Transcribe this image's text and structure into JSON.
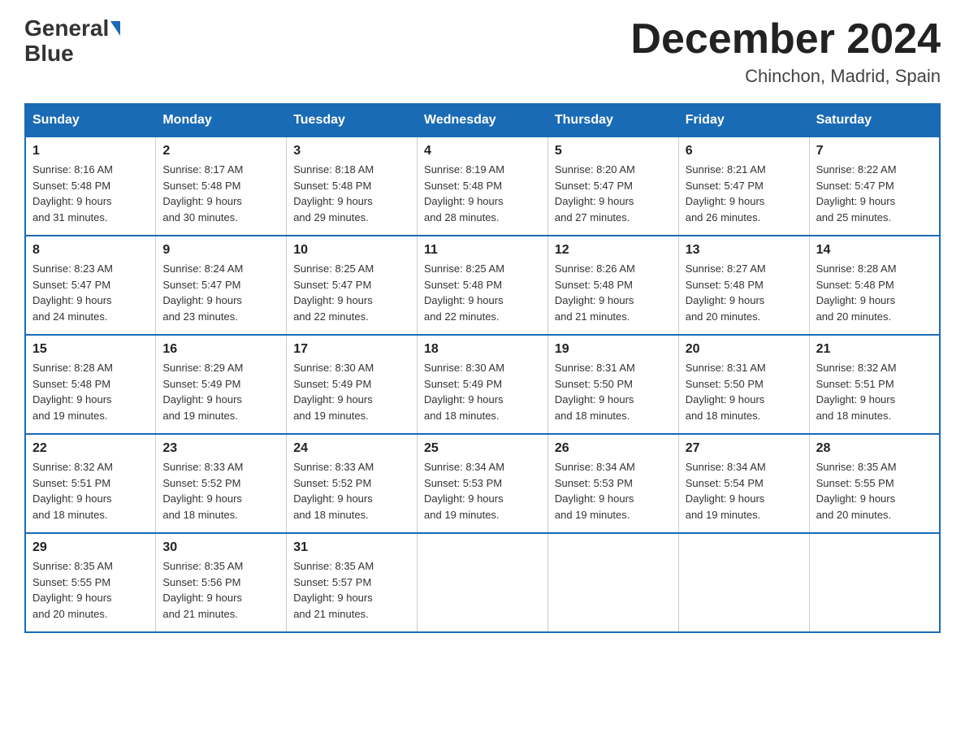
{
  "header": {
    "logo_general": "General",
    "logo_blue": "Blue",
    "month_title": "December 2024",
    "location": "Chinchon, Madrid, Spain"
  },
  "weekdays": [
    "Sunday",
    "Monday",
    "Tuesday",
    "Wednesday",
    "Thursday",
    "Friday",
    "Saturday"
  ],
  "weeks": [
    [
      {
        "day": "1",
        "sunrise": "8:16 AM",
        "sunset": "5:48 PM",
        "daylight": "9 hours and 31 minutes."
      },
      {
        "day": "2",
        "sunrise": "8:17 AM",
        "sunset": "5:48 PM",
        "daylight": "9 hours and 30 minutes."
      },
      {
        "day": "3",
        "sunrise": "8:18 AM",
        "sunset": "5:48 PM",
        "daylight": "9 hours and 29 minutes."
      },
      {
        "day": "4",
        "sunrise": "8:19 AM",
        "sunset": "5:48 PM",
        "daylight": "9 hours and 28 minutes."
      },
      {
        "day": "5",
        "sunrise": "8:20 AM",
        "sunset": "5:47 PM",
        "daylight": "9 hours and 27 minutes."
      },
      {
        "day": "6",
        "sunrise": "8:21 AM",
        "sunset": "5:47 PM",
        "daylight": "9 hours and 26 minutes."
      },
      {
        "day": "7",
        "sunrise": "8:22 AM",
        "sunset": "5:47 PM",
        "daylight": "9 hours and 25 minutes."
      }
    ],
    [
      {
        "day": "8",
        "sunrise": "8:23 AM",
        "sunset": "5:47 PM",
        "daylight": "9 hours and 24 minutes."
      },
      {
        "day": "9",
        "sunrise": "8:24 AM",
        "sunset": "5:47 PM",
        "daylight": "9 hours and 23 minutes."
      },
      {
        "day": "10",
        "sunrise": "8:25 AM",
        "sunset": "5:47 PM",
        "daylight": "9 hours and 22 minutes."
      },
      {
        "day": "11",
        "sunrise": "8:25 AM",
        "sunset": "5:48 PM",
        "daylight": "9 hours and 22 minutes."
      },
      {
        "day": "12",
        "sunrise": "8:26 AM",
        "sunset": "5:48 PM",
        "daylight": "9 hours and 21 minutes."
      },
      {
        "day": "13",
        "sunrise": "8:27 AM",
        "sunset": "5:48 PM",
        "daylight": "9 hours and 20 minutes."
      },
      {
        "day": "14",
        "sunrise": "8:28 AM",
        "sunset": "5:48 PM",
        "daylight": "9 hours and 20 minutes."
      }
    ],
    [
      {
        "day": "15",
        "sunrise": "8:28 AM",
        "sunset": "5:48 PM",
        "daylight": "9 hours and 19 minutes."
      },
      {
        "day": "16",
        "sunrise": "8:29 AM",
        "sunset": "5:49 PM",
        "daylight": "9 hours and 19 minutes."
      },
      {
        "day": "17",
        "sunrise": "8:30 AM",
        "sunset": "5:49 PM",
        "daylight": "9 hours and 19 minutes."
      },
      {
        "day": "18",
        "sunrise": "8:30 AM",
        "sunset": "5:49 PM",
        "daylight": "9 hours and 18 minutes."
      },
      {
        "day": "19",
        "sunrise": "8:31 AM",
        "sunset": "5:50 PM",
        "daylight": "9 hours and 18 minutes."
      },
      {
        "day": "20",
        "sunrise": "8:31 AM",
        "sunset": "5:50 PM",
        "daylight": "9 hours and 18 minutes."
      },
      {
        "day": "21",
        "sunrise": "8:32 AM",
        "sunset": "5:51 PM",
        "daylight": "9 hours and 18 minutes."
      }
    ],
    [
      {
        "day": "22",
        "sunrise": "8:32 AM",
        "sunset": "5:51 PM",
        "daylight": "9 hours and 18 minutes."
      },
      {
        "day": "23",
        "sunrise": "8:33 AM",
        "sunset": "5:52 PM",
        "daylight": "9 hours and 18 minutes."
      },
      {
        "day": "24",
        "sunrise": "8:33 AM",
        "sunset": "5:52 PM",
        "daylight": "9 hours and 18 minutes."
      },
      {
        "day": "25",
        "sunrise": "8:34 AM",
        "sunset": "5:53 PM",
        "daylight": "9 hours and 19 minutes."
      },
      {
        "day": "26",
        "sunrise": "8:34 AM",
        "sunset": "5:53 PM",
        "daylight": "9 hours and 19 minutes."
      },
      {
        "day": "27",
        "sunrise": "8:34 AM",
        "sunset": "5:54 PM",
        "daylight": "9 hours and 19 minutes."
      },
      {
        "day": "28",
        "sunrise": "8:35 AM",
        "sunset": "5:55 PM",
        "daylight": "9 hours and 20 minutes."
      }
    ],
    [
      {
        "day": "29",
        "sunrise": "8:35 AM",
        "sunset": "5:55 PM",
        "daylight": "9 hours and 20 minutes."
      },
      {
        "day": "30",
        "sunrise": "8:35 AM",
        "sunset": "5:56 PM",
        "daylight": "9 hours and 21 minutes."
      },
      {
        "day": "31",
        "sunrise": "8:35 AM",
        "sunset": "5:57 PM",
        "daylight": "9 hours and 21 minutes."
      },
      null,
      null,
      null,
      null
    ]
  ],
  "labels": {
    "sunrise": "Sunrise:",
    "sunset": "Sunset:",
    "daylight": "Daylight:"
  }
}
